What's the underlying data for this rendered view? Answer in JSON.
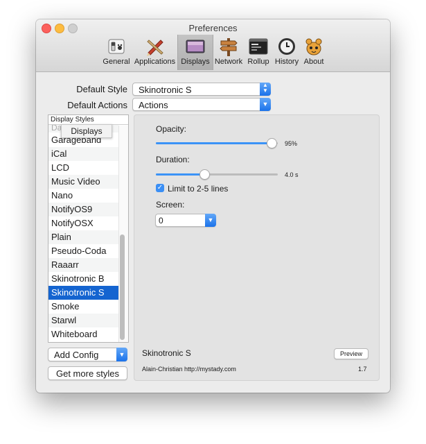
{
  "window": {
    "title": "Preferences"
  },
  "toolbar": {
    "items": [
      {
        "label": "General",
        "icon": "general-switch-icon"
      },
      {
        "label": "Applications",
        "icon": "applications-pencil-icon"
      },
      {
        "label": "Displays",
        "icon": "displays-monitor-icon"
      },
      {
        "label": "Network",
        "icon": "network-signpost-icon"
      },
      {
        "label": "Rollup",
        "icon": "rollup-terminal-icon"
      },
      {
        "label": "History",
        "icon": "history-clock-icon"
      },
      {
        "label": "About",
        "icon": "about-paw-icon"
      }
    ],
    "selected": "Displays"
  },
  "form": {
    "default_style_label": "Default Style",
    "default_style_value": "Skinotronic S",
    "default_actions_label": "Default Actions",
    "default_actions_value": "Actions"
  },
  "styles_list": {
    "header": "Display Styles",
    "partial_item": "Darkroom",
    "tooltip": "Displays",
    "items": [
      "Garageband",
      "iCal",
      "LCD",
      "Music Video",
      "Nano",
      "NotifyOS9",
      "NotifyOSX",
      "Plain",
      "Pseudo-Coda",
      "Raaarr",
      "Skinotronic B",
      "Skinotronic S",
      "Smoke",
      "Starwl",
      "Whiteboard"
    ],
    "selected": "Skinotronic S"
  },
  "buttons": {
    "add_config": "Add Config",
    "get_more_styles": "Get more styles",
    "preview": "Preview"
  },
  "settings": {
    "opacity_label": "Opacity:",
    "opacity_value": "95%",
    "opacity_fraction": 0.95,
    "duration_label": "Duration:",
    "duration_value": "4.0 s",
    "duration_fraction": 0.4,
    "limit_lines_label": "Limit to 2-5 lines",
    "limit_lines_checked": true,
    "screen_label": "Screen:",
    "screen_value": "0"
  },
  "style_info": {
    "name": "Skinotronic S",
    "author": "Alain-Christian http://mystady.com",
    "version": "1.7"
  },
  "colors": {
    "accent": "#3b93f7",
    "selection": "#1464d0"
  }
}
